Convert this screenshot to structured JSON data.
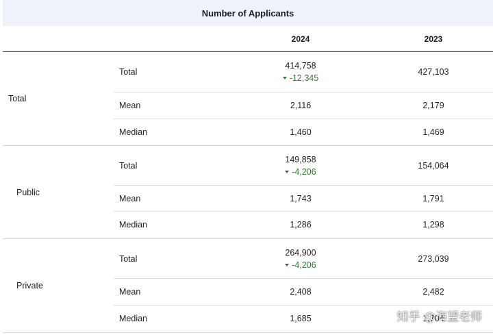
{
  "table": {
    "title": "Number of Applicants",
    "columns": [
      "2024",
      "2023"
    ],
    "groups": [
      {
        "label": "Total",
        "rows": [
          {
            "stat": "Total",
            "v2024": "414,758",
            "delta": "-12,345",
            "v2023": "427,103"
          },
          {
            "stat": "Mean",
            "v2024": "2,116",
            "v2023": "2,179"
          },
          {
            "stat": "Median",
            "v2024": "1,460",
            "v2023": "1,469"
          }
        ]
      },
      {
        "label": "Public",
        "rows": [
          {
            "stat": "Total",
            "v2024": "149,858",
            "delta": "-4,206",
            "v2023": "154,064"
          },
          {
            "stat": "Mean",
            "v2024": "1,743",
            "v2023": "1,791"
          },
          {
            "stat": "Median",
            "v2024": "1,286",
            "v2023": "1,298"
          }
        ]
      },
      {
        "label": "Private",
        "rows": [
          {
            "stat": "Total",
            "v2024": "264,900",
            "delta": "-4,206",
            "v2023": "273,039"
          },
          {
            "stat": "Mean",
            "v2024": "2,408",
            "v2023": "2,482"
          },
          {
            "stat": "Median",
            "v2024": "1,685",
            "v2023": "1,704"
          }
        ]
      }
    ],
    "delta_color": "#2e7d32",
    "delta_icon": "triangle-down-icon"
  },
  "watermark": "知乎 @海望老师"
}
